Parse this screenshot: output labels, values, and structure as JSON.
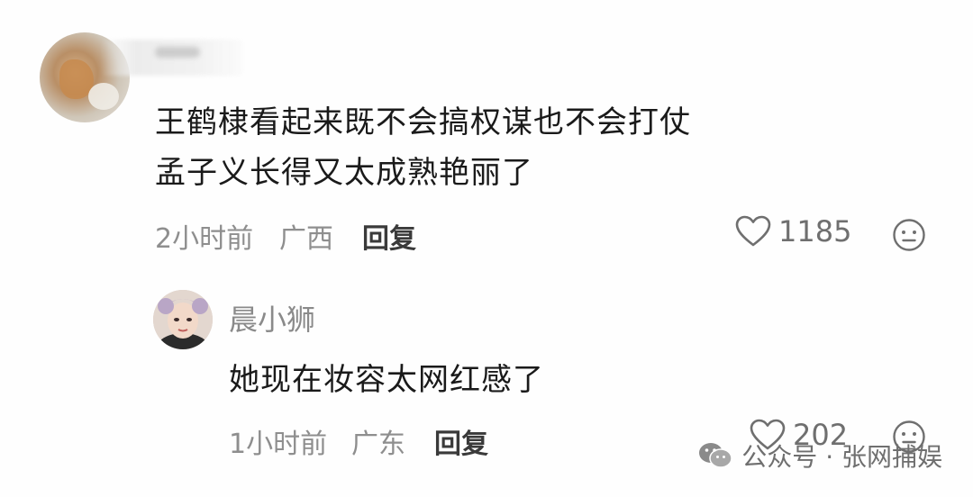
{
  "comment": {
    "line1": "王鹤棣看起来既不会搞权谋也不会打仗",
    "line2": "孟子义长得又太成熟艳丽了",
    "time": "2小时前",
    "location": "广西",
    "reply_label": "回复",
    "likes": "1185"
  },
  "reply": {
    "username": "晨小狮",
    "text": "她现在妆容太网红感了",
    "time": "1小时前",
    "location": "广东",
    "reply_label": "回复",
    "likes": "202"
  },
  "watermark": {
    "text": "公众号 · 张网捕娱"
  },
  "icons": {
    "like": "heart-outline-icon",
    "react": "neutral-face-icon",
    "watermark": "wechat-icon"
  }
}
